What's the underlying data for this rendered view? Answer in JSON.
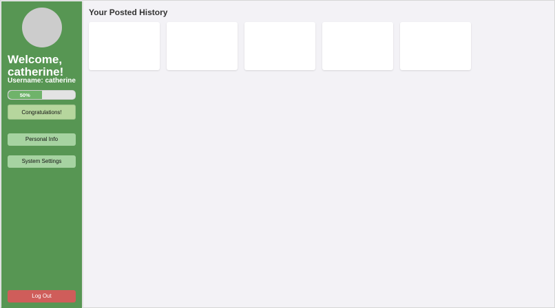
{
  "sidebar": {
    "welcome_text": "Welcome, catherine!",
    "username_text": "Username: catherine",
    "progress": {
      "value": 0.5,
      "label": "50%"
    },
    "buttons": {
      "congratulations": "Congratulations!",
      "personal_info": "Personal Info",
      "system_settings": "System Settings",
      "logout": "Log Out"
    }
  },
  "main": {
    "title": "Your Posted History",
    "cards_count": 5
  },
  "colors": {
    "sidebar_bg": "#579653",
    "progress_fill": "#6fb36a",
    "button_bg": "#a6d3a1",
    "logout_bg": "#cf5d5a",
    "page_bg": "#f3f2f6"
  }
}
